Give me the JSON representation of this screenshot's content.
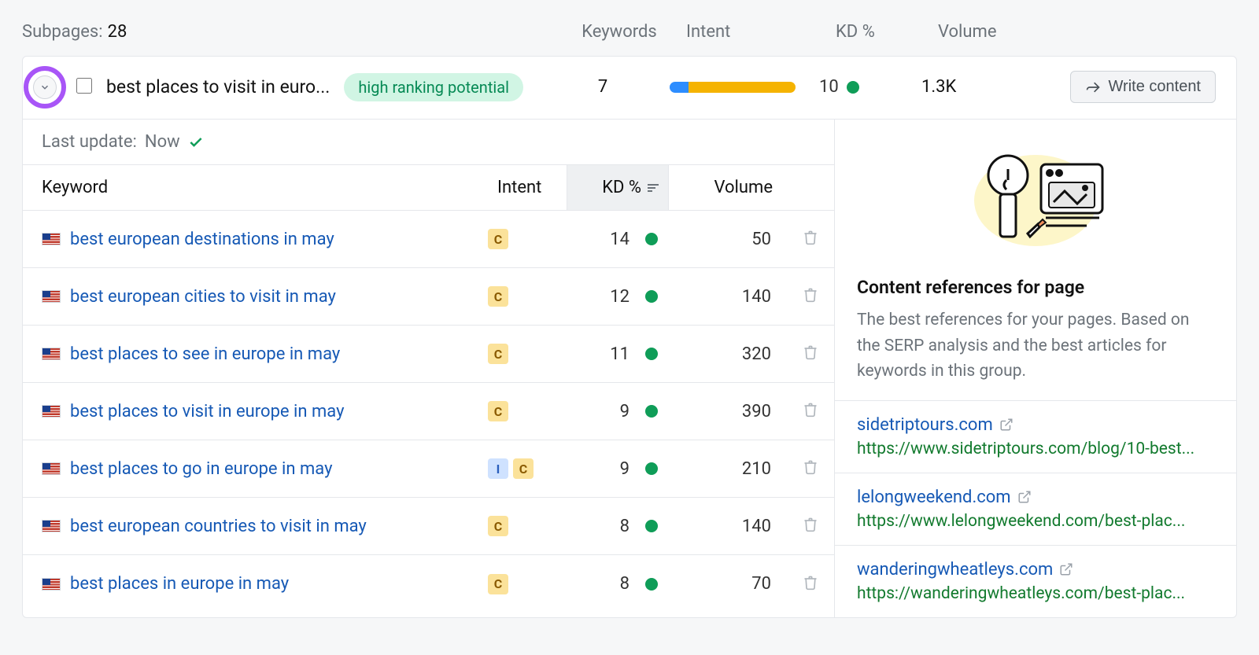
{
  "header": {
    "subpages_label": "Subpages:",
    "subpages_count": "28",
    "col_keywords": "Keywords",
    "col_intent": "Intent",
    "col_kd": "KD %",
    "col_volume": "Volume"
  },
  "summary": {
    "title": "best places to visit in euro...",
    "tag": "high ranking potential",
    "keywords": "7",
    "intent_seg1_pct": 15,
    "intent_seg2_pct": 85,
    "kd": "10",
    "volume": "1.3K",
    "write_btn": "Write content"
  },
  "lastupdate": {
    "label": "Last update:",
    "value": "Now"
  },
  "table": {
    "head_keyword": "Keyword",
    "head_intent": "Intent",
    "head_kd": "KD %",
    "head_volume": "Volume",
    "rows": [
      {
        "keyword": "best european destinations in may",
        "intents": [
          "C"
        ],
        "kd": "14",
        "volume": "50"
      },
      {
        "keyword": "best european cities to visit in may",
        "intents": [
          "C"
        ],
        "kd": "12",
        "volume": "140"
      },
      {
        "keyword": "best places to see in europe in may",
        "intents": [
          "C"
        ],
        "kd": "11",
        "volume": "320"
      },
      {
        "keyword": "best places to visit in europe in may",
        "intents": [
          "C"
        ],
        "kd": "9",
        "volume": "390"
      },
      {
        "keyword": "best places to go in europe in may",
        "intents": [
          "I",
          "C"
        ],
        "kd": "9",
        "volume": "210"
      },
      {
        "keyword": "best european countries to visit in may",
        "intents": [
          "C"
        ],
        "kd": "8",
        "volume": "140"
      },
      {
        "keyword": "best places in europe in may",
        "intents": [
          "C"
        ],
        "kd": "8",
        "volume": "70"
      }
    ]
  },
  "references": {
    "title": "Content references for page",
    "desc": "The best references for your pages. Based on the SERP analysis and the best articles for keywords in this group.",
    "items": [
      {
        "domain": "sidetriptours.com",
        "url": "https://www.sidetriptours.com/blog/10-best..."
      },
      {
        "domain": "lelongweekend.com",
        "url": "https://www.lelongweekend.com/best-plac..."
      },
      {
        "domain": "wanderingwheatleys.com",
        "url": "https://wanderingwheatleys.com/best-plac..."
      }
    ]
  }
}
